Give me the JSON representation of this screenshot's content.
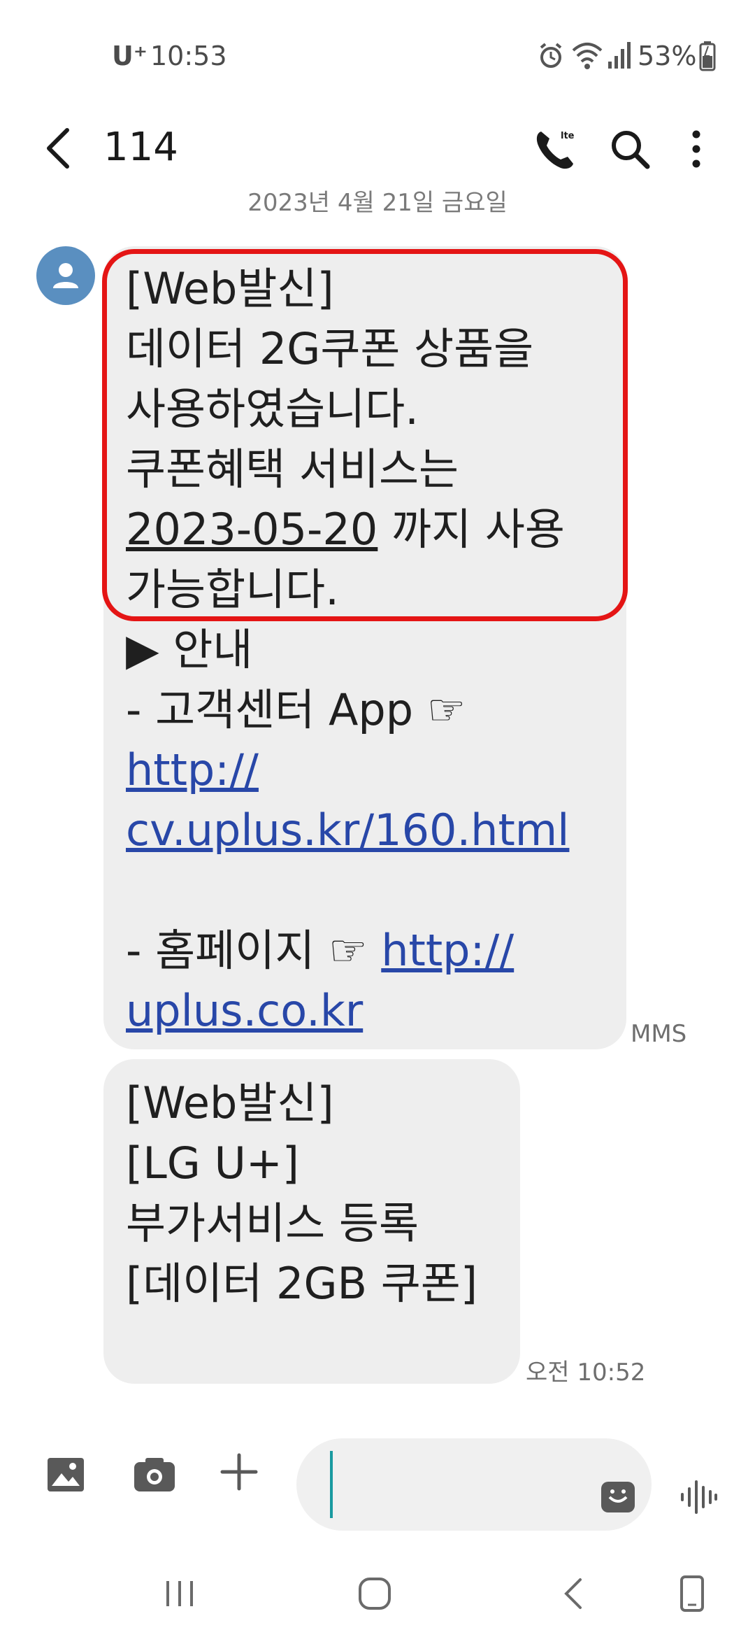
{
  "status_bar": {
    "carrier": "U⁺",
    "time": "10:53",
    "battery": "53%"
  },
  "header": {
    "title": "114",
    "icons": [
      "back-icon",
      "call-icon",
      "search-icon",
      "more-icon"
    ]
  },
  "date_divider": "2023년 4월 21일 금요일",
  "messages": [
    {
      "lines_highlighted": [
        "[Web발신]",
        "데이터 2G쿠폰 상품을",
        "사용하였습니다.",
        "쿠폰혜택 서비스는"
      ],
      "date_underlined": "2023-05-20",
      "date_suffix": " 까지 사용",
      "line_last_highlight": "가능합니다.",
      "guide_line": "▶  안내",
      "app_line": "- 고객센터 App ☞",
      "app_link_1": "http://",
      "app_link_2": "cv.uplus.kr/160.html",
      "home_line": "- 홈페이지 ☞ ",
      "home_link_1": "http://",
      "home_link_2": "uplus.co.kr",
      "label": "MMS"
    },
    {
      "lines": [
        "[Web발신]",
        "[LG U+]",
        "부가서비스 등록",
        "[데이터 2GB 쿠폰]"
      ],
      "time": "오전 10:52"
    }
  ],
  "colors": {
    "highlight_border": "#e41515",
    "link": "#2847a8",
    "bubble": "#eeeeee",
    "avatar": "#5a8fc0"
  }
}
